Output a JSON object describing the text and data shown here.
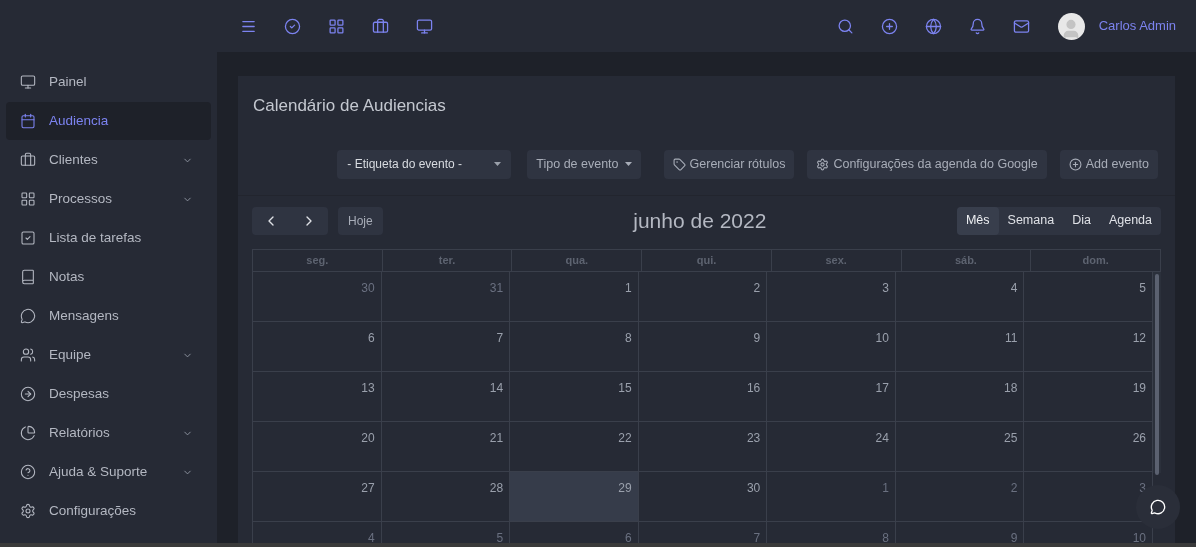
{
  "topbar": {
    "user": "Carlos Admin"
  },
  "sidebar": {
    "items": [
      {
        "label": "Painel",
        "kind": "monitor",
        "selected": false,
        "expandable": false
      },
      {
        "label": "Audiencia",
        "kind": "calendar",
        "selected": true,
        "expandable": false
      },
      {
        "label": "Clientes",
        "kind": "briefcase",
        "selected": false,
        "expandable": true
      },
      {
        "label": "Processos",
        "kind": "grid",
        "selected": false,
        "expandable": true
      },
      {
        "label": "Lista de tarefas",
        "kind": "check",
        "selected": false,
        "expandable": false
      },
      {
        "label": "Notas",
        "kind": "book",
        "selected": false,
        "expandable": false
      },
      {
        "label": "Mensagens",
        "kind": "message",
        "selected": false,
        "expandable": false
      },
      {
        "label": "Equipe",
        "kind": "users",
        "selected": false,
        "expandable": true
      },
      {
        "label": "Despesas",
        "kind": "arrow",
        "selected": false,
        "expandable": false
      },
      {
        "label": "Relatórios",
        "kind": "pie",
        "selected": false,
        "expandable": true
      },
      {
        "label": "Ajuda & Suporte",
        "kind": "help",
        "selected": false,
        "expandable": true
      },
      {
        "label": "Configurações",
        "kind": "settings",
        "selected": false,
        "expandable": false
      }
    ]
  },
  "page": {
    "title": "Calendário de Audiencias",
    "filters": [
      {
        "kind": "select",
        "label": "- Etiqueta do evento -"
      },
      {
        "kind": "dropdown",
        "label": "Tipo de evento"
      }
    ],
    "actions": [
      {
        "kind": "tag",
        "label": "Gerenciar rótulos"
      },
      {
        "kind": "gear",
        "label": "Configurações da agenda do Google"
      },
      {
        "kind": "plus",
        "label": "Add evento"
      }
    ]
  },
  "calendar": {
    "today_button": "Hoje",
    "month": "junho de 2022",
    "views": [
      {
        "label": "Mês",
        "selected": true
      },
      {
        "label": "Semana",
        "selected": false
      },
      {
        "label": "Dia",
        "selected": false
      },
      {
        "label": "Agenda",
        "selected": false
      }
    ],
    "weekdays": [
      "seg.",
      "ter.",
      "qua.",
      "qui.",
      "sex.",
      "sáb.",
      "dom."
    ],
    "weeks": [
      [
        {
          "day": "30",
          "other": true,
          "today": false
        },
        {
          "day": "31",
          "other": true,
          "today": false
        },
        {
          "day": "1",
          "other": false,
          "today": false
        },
        {
          "day": "2",
          "other": false,
          "today": false
        },
        {
          "day": "3",
          "other": false,
          "today": false
        },
        {
          "day": "4",
          "other": false,
          "today": false
        },
        {
          "day": "5",
          "other": false,
          "today": false
        }
      ],
      [
        {
          "day": "6",
          "other": false,
          "today": false
        },
        {
          "day": "7",
          "other": false,
          "today": false
        },
        {
          "day": "8",
          "other": false,
          "today": false
        },
        {
          "day": "9",
          "other": false,
          "today": false
        },
        {
          "day": "10",
          "other": false,
          "today": false
        },
        {
          "day": "11",
          "other": false,
          "today": false
        },
        {
          "day": "12",
          "other": false,
          "today": false
        }
      ],
      [
        {
          "day": "13",
          "other": false,
          "today": false
        },
        {
          "day": "14",
          "other": false,
          "today": false
        },
        {
          "day": "15",
          "other": false,
          "today": false
        },
        {
          "day": "16",
          "other": false,
          "today": false
        },
        {
          "day": "17",
          "other": false,
          "today": false
        },
        {
          "day": "18",
          "other": false,
          "today": false
        },
        {
          "day": "19",
          "other": false,
          "today": false
        }
      ],
      [
        {
          "day": "20",
          "other": false,
          "today": false
        },
        {
          "day": "21",
          "other": false,
          "today": false
        },
        {
          "day": "22",
          "other": false,
          "today": false
        },
        {
          "day": "23",
          "other": false,
          "today": false
        },
        {
          "day": "24",
          "other": false,
          "today": false
        },
        {
          "day": "25",
          "other": false,
          "today": false
        },
        {
          "day": "26",
          "other": false,
          "today": false
        }
      ],
      [
        {
          "day": "27",
          "other": false,
          "today": false
        },
        {
          "day": "28",
          "other": false,
          "today": false
        },
        {
          "day": "29",
          "other": false,
          "today": true
        },
        {
          "day": "30",
          "other": false,
          "today": false
        },
        {
          "day": "1",
          "other": true,
          "today": false
        },
        {
          "day": "2",
          "other": true,
          "today": false
        },
        {
          "day": "3",
          "other": true,
          "today": false
        }
      ],
      [
        {
          "day": "4",
          "other": true,
          "today": false
        },
        {
          "day": "5",
          "other": true,
          "today": false
        },
        {
          "day": "6",
          "other": true,
          "today": false
        },
        {
          "day": "7",
          "other": true,
          "today": false
        },
        {
          "day": "8",
          "other": true,
          "today": false
        },
        {
          "day": "9",
          "other": true,
          "today": false
        },
        {
          "day": "10",
          "other": true,
          "today": false
        }
      ]
    ]
  }
}
